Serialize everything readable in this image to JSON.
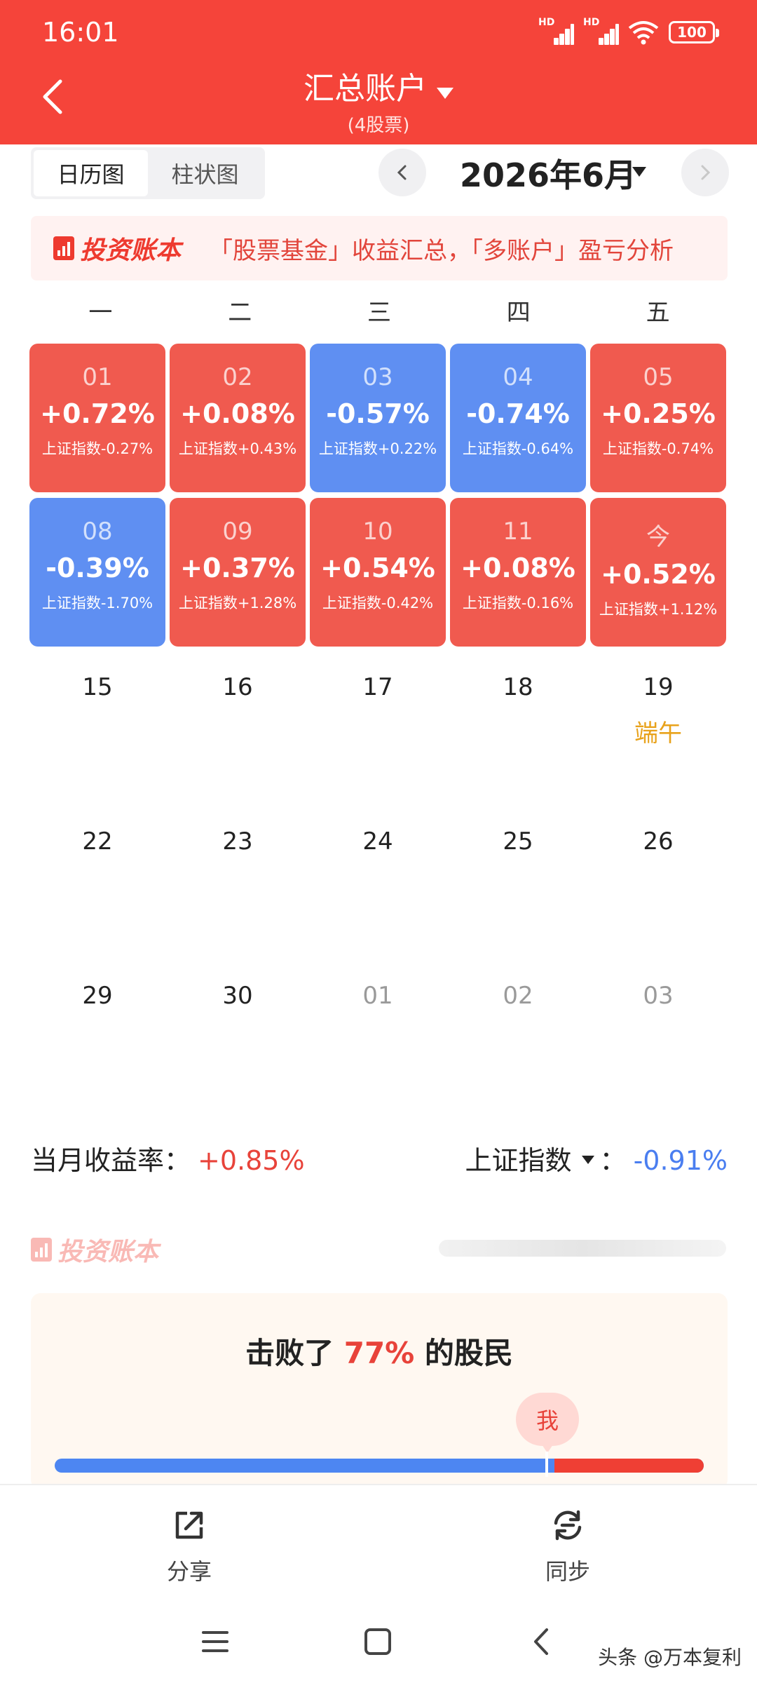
{
  "status_bar": {
    "time": "16:01",
    "network_1": "HD",
    "network_2": "HD",
    "battery": "100"
  },
  "header": {
    "title": "汇总账户",
    "subtitle": "(4股票)"
  },
  "view_toggle": {
    "calendar": "日历图",
    "bar": "柱状图"
  },
  "month_nav": {
    "label": "2026年6月"
  },
  "banner": {
    "brand": "投资账本",
    "text": "「股票基金」收益汇总，「多账户」盈亏分析"
  },
  "weekdays": [
    "一",
    "二",
    "三",
    "四",
    "五"
  ],
  "calendar": {
    "row1": [
      {
        "day": "01",
        "pct": "+0.72%",
        "idx": "上证指数-0.27%",
        "dir": "up"
      },
      {
        "day": "02",
        "pct": "+0.08%",
        "idx": "上证指数+0.43%",
        "dir": "up"
      },
      {
        "day": "03",
        "pct": "-0.57%",
        "idx": "上证指数+0.22%",
        "dir": "down"
      },
      {
        "day": "04",
        "pct": "-0.74%",
        "idx": "上证指数-0.64%",
        "dir": "down"
      },
      {
        "day": "05",
        "pct": "+0.25%",
        "idx": "上证指数-0.74%",
        "dir": "up"
      }
    ],
    "row2": [
      {
        "day": "08",
        "pct": "-0.39%",
        "idx": "上证指数-1.70%",
        "dir": "down"
      },
      {
        "day": "09",
        "pct": "+0.37%",
        "idx": "上证指数+1.28%",
        "dir": "up"
      },
      {
        "day": "10",
        "pct": "+0.54%",
        "idx": "上证指数-0.42%",
        "dir": "up"
      },
      {
        "day": "11",
        "pct": "+0.08%",
        "idx": "上证指数-0.16%",
        "dir": "up"
      },
      {
        "day": "今",
        "pct": "+0.52%",
        "idx": "上证指数+1.12%",
        "dir": "up"
      }
    ],
    "row3": [
      "15",
      "16",
      "17",
      "18",
      "19"
    ],
    "row3_holiday": "端午",
    "row4": [
      "22",
      "23",
      "24",
      "25",
      "26"
    ],
    "row5": [
      "29",
      "30",
      "01",
      "02",
      "03"
    ]
  },
  "colors": {
    "header": "#f5443a",
    "up": "#f05a4f",
    "down": "#5f8ff2",
    "holiday": "#e8a21b"
  },
  "summary": {
    "month_label": "当月收益率：",
    "month_value": "+0.85%",
    "index_label": "上证指数",
    "index_sep": "：",
    "index_value": "-0.91%"
  },
  "watermark": {
    "brand": "投资账本"
  },
  "beat": {
    "prefix": "击败了 ",
    "value": "77%",
    "suffix": " 的股民",
    "me": "我",
    "fraction": 0.77
  },
  "actions": {
    "share": "分享",
    "sync": "同步"
  },
  "footer": {
    "credit": "头条 @万本复利"
  }
}
